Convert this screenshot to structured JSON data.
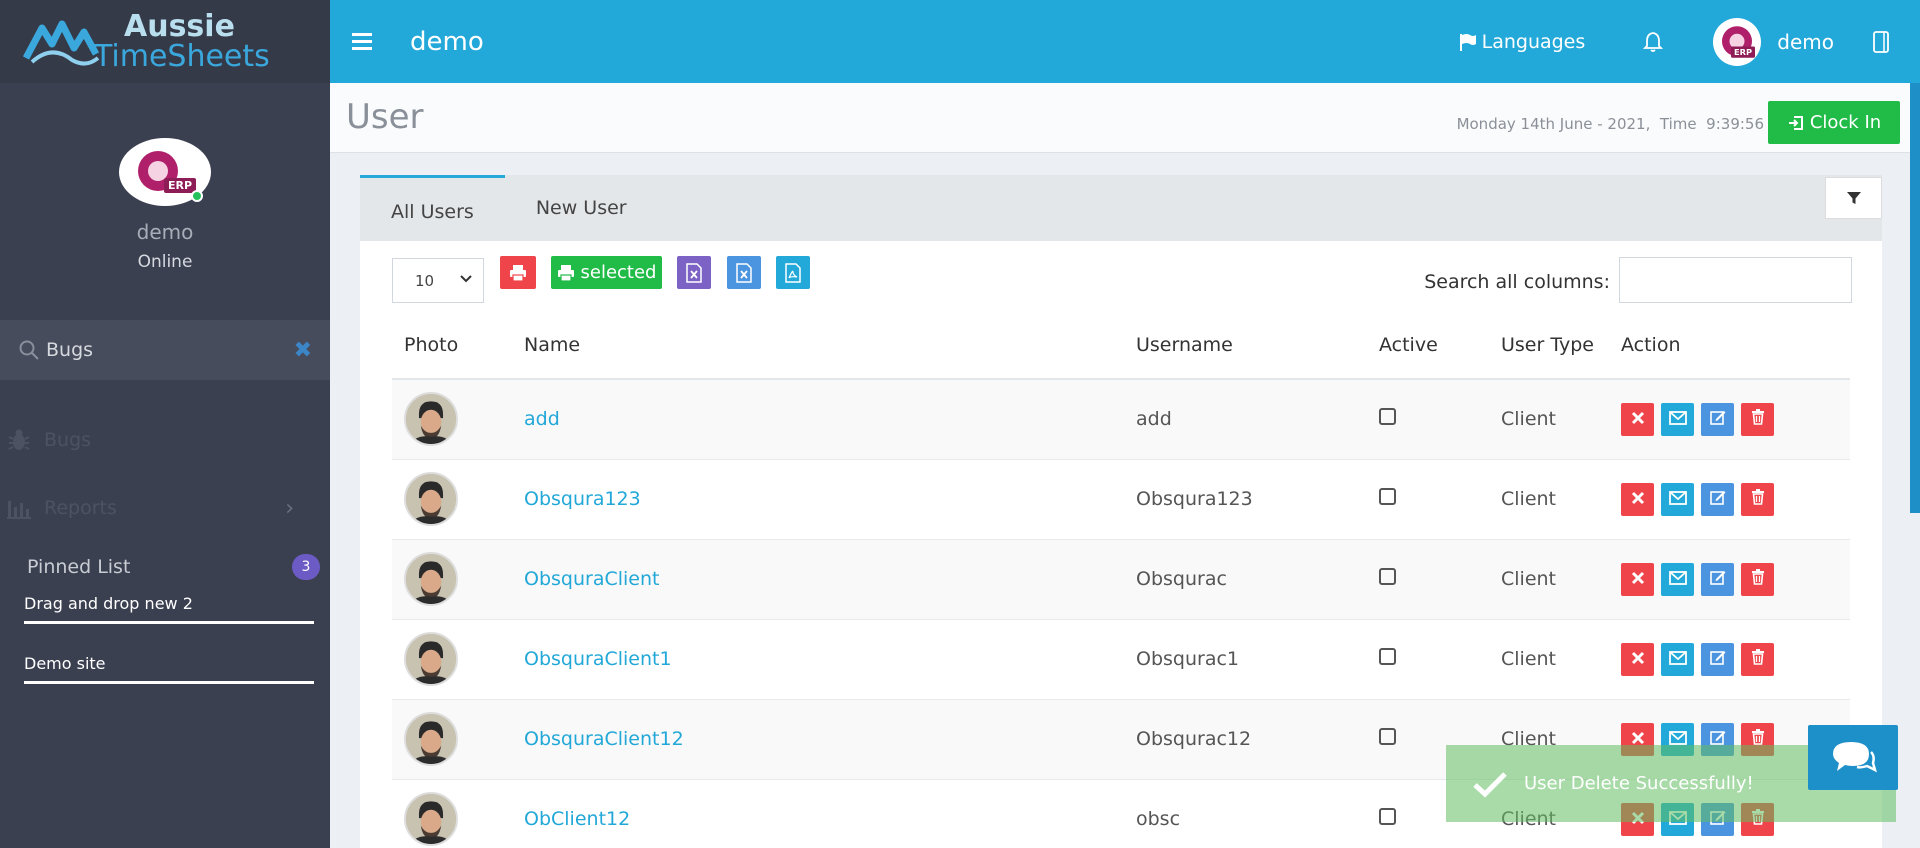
{
  "brand": {
    "line1": "Aussie",
    "line2": "TimeSheets",
    "badge": "ERP"
  },
  "sidebar": {
    "user_name": "demo",
    "status": "Online",
    "search_value": "Bugs",
    "menu": [
      {
        "label": "Bugs",
        "icon": "bug-icon"
      },
      {
        "label": "Reports",
        "icon": "bar-chart-icon"
      }
    ],
    "pinned_label": "Pinned List",
    "pinned_count": "3",
    "pinned_items": [
      "Drag and drop new 2",
      "Demo site"
    ]
  },
  "topbar": {
    "title": "demo",
    "languages": "Languages",
    "user": "demo"
  },
  "page": {
    "title": "User",
    "date": "Monday 14th June - 2021,",
    "time_label": "Time",
    "time": "9:39:56",
    "clock_in": "Clock In"
  },
  "tabs": [
    "All Users",
    "New User"
  ],
  "toolbar": {
    "page_length": "10",
    "print_selected": "selected",
    "search_label": "Search all columns:",
    "search_value": ""
  },
  "table": {
    "headers": [
      "Photo",
      "Name",
      "Username",
      "Active",
      "User Type",
      "Action"
    ],
    "rows": [
      {
        "name": "add",
        "username": "add",
        "type": "Client"
      },
      {
        "name": "Obsqura123",
        "username": "Obsqura123",
        "type": "Client"
      },
      {
        "name": "ObsquraClient",
        "username": "Obsqurac",
        "type": "Client"
      },
      {
        "name": "ObsquraClient1",
        "username": "Obsqurac1",
        "type": "Client"
      },
      {
        "name": "ObsquraClient12",
        "username": "Obsqurac12",
        "type": "Client"
      },
      {
        "name": "ObClient12",
        "username": "obsc",
        "type": "Client"
      }
    ]
  },
  "toast": {
    "message": "User Delete Successfully!"
  },
  "colors": {
    "topbar": "#23a9d9",
    "sidebar": "#3b4051",
    "success": "#21bb47",
    "danger": "#ef4449"
  }
}
